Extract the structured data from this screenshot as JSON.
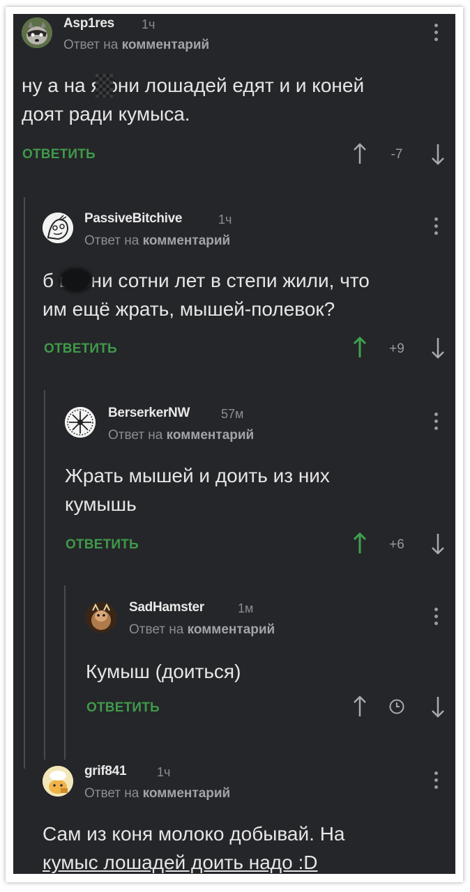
{
  "colors": {
    "background": "#252629",
    "reply_green": "#3f9a4a",
    "upvote_green": "#3fa34d",
    "text": "#e6e6e6",
    "muted": "#8c8d90"
  },
  "comments": [
    {
      "user": "Asp1res",
      "time": "1ч",
      "reply_prefix": "Ответ на",
      "reply_target": "комментарий",
      "text_line1": "ну а на    я они лошадей едят и и коней",
      "text_line2": "доят ради кумыса.",
      "reply_label": "ОТВЕТИТЬ",
      "rating": "-7",
      "upvoted": false
    },
    {
      "user": "PassiveBitchive",
      "time": "1ч",
      "reply_prefix": "Ответ на",
      "reply_target": "комментарий",
      "text_line1": "б      ь, они сотни лет в степи жили, что",
      "text_line2": "им ещё жрать, мышей-полевок?",
      "reply_label": "ОТВЕТИТЬ",
      "rating": "+9",
      "upvoted": true
    },
    {
      "user": "BerserkerNW",
      "time": "57м",
      "reply_prefix": "Ответ на",
      "reply_target": "комментарий",
      "text_line1": "Жрать мышей и доить из них",
      "text_line2": "кумышь",
      "reply_label": "ОТВЕТИТЬ",
      "rating": "+6",
      "upvoted": true
    },
    {
      "user": "SadHamster",
      "time": "1м",
      "reply_prefix": "Ответ на",
      "reply_target": "комментарий",
      "text_line1": "Кумыш (доиться)",
      "reply_label": "ОТВЕТИТЬ",
      "rating_icon": "clock-icon",
      "upvoted": false
    },
    {
      "user": "grif841",
      "time": "1ч",
      "reply_prefix": "Ответ на",
      "reply_target": "комментарий",
      "text_line1": "Сам из коня молоко добывай. На",
      "text_line2": "кумыс лошадей доить надо :D"
    }
  ]
}
